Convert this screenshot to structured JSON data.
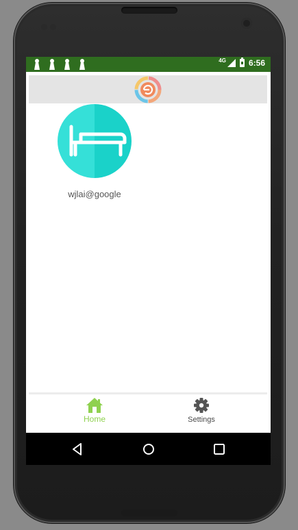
{
  "status_bar": {
    "network_type": "4G",
    "time": "6:56",
    "notification_icons": [
      "notification-icon",
      "notification-icon",
      "notification-icon",
      "notification-icon"
    ],
    "background_color": "#2f6d1f"
  },
  "toolbar": {
    "logo_icon": "app-logo-icon",
    "background_color": "#e4e4e4"
  },
  "profile": {
    "avatar_icon": "bed-icon",
    "avatar_color": "#2fd8d0",
    "username": "wjlai@google"
  },
  "bottom_nav": {
    "items": [
      {
        "label": "Home",
        "icon": "home-icon",
        "active": true
      },
      {
        "label": "Settings",
        "icon": "gear-icon",
        "active": false
      }
    ],
    "active_color": "#8fd14f",
    "inactive_color": "#4a4a4a"
  },
  "system_nav": {
    "buttons": [
      "back-icon",
      "home-circle-icon",
      "recents-icon"
    ]
  }
}
